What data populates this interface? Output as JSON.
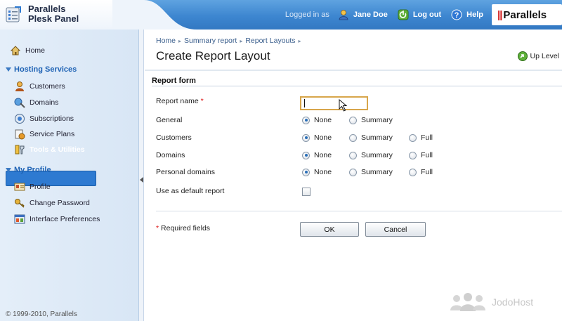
{
  "header": {
    "product_title_line1": "Parallels",
    "product_title_line2": "Plesk Panel",
    "logged_in_prefix": "Logged in as",
    "user_name": "Jane Doe",
    "logout_label": "Log out",
    "help_label": "Help",
    "vendor_logo_text": "Parallels"
  },
  "sidebar": {
    "home_label": "Home",
    "hosting_section": "Hosting Services",
    "items": [
      {
        "label": "Customers",
        "icon": "customers-icon"
      },
      {
        "label": "Domains",
        "icon": "domains-icon"
      },
      {
        "label": "Subscriptions",
        "icon": "subscriptions-icon"
      },
      {
        "label": "Service Plans",
        "icon": "service-plans-icon"
      },
      {
        "label": "Tools & Utilities",
        "icon": "tools-icon",
        "active": true
      }
    ],
    "profile_section": "My Profile",
    "profile_items": [
      {
        "label": "Profile",
        "icon": "profile-icon"
      },
      {
        "label": "Change Password",
        "icon": "password-icon"
      },
      {
        "label": "Interface Preferences",
        "icon": "preferences-icon"
      }
    ],
    "copyright": "© 1999-2010, Parallels"
  },
  "main": {
    "breadcrumbs": [
      "Home",
      "Summary report",
      "Report Layouts"
    ],
    "page_title": "Create Report Layout",
    "up_level_label": "Up Level",
    "form_legend": "Report form",
    "fields": {
      "report_name_label": "Report name",
      "report_name_value": "",
      "general_label": "General",
      "customers_label": "Customers",
      "domains_label": "Domains",
      "personal_domains_label": "Personal domains",
      "default_label": "Use as default report"
    },
    "options": {
      "none": "None",
      "summary": "Summary",
      "full": "Full"
    },
    "required_note": "Required fields",
    "ok_label": "OK",
    "cancel_label": "Cancel"
  },
  "watermark_text": "JodoHost",
  "colors": {
    "header_blue": "#3d86d0",
    "active_nav": "#2e7ad1",
    "section_blue": "#1f63b5",
    "required_red": "#dd1111",
    "focus_border": "#d8a64b"
  }
}
